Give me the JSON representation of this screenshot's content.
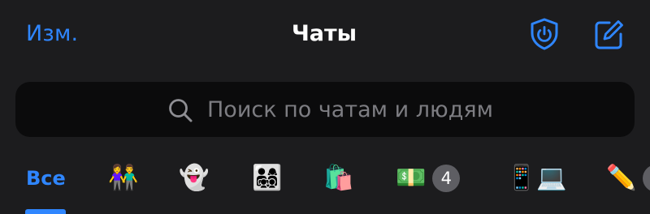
{
  "header": {
    "edit_label": "Изм.",
    "title": "Чаты",
    "shield_icon": "shield-power-icon",
    "compose_icon": "compose-icon"
  },
  "search": {
    "placeholder": "Поиск по чатам и людям",
    "value": "",
    "icon": "search-icon"
  },
  "tabs": [
    {
      "label": "Все",
      "selected": true
    },
    {
      "label": "👫"
    },
    {
      "label": "👻"
    },
    {
      "label": "👨‍👩‍👧‍👦"
    },
    {
      "label": "🛍️"
    },
    {
      "label": "💵",
      "badge": "4"
    },
    {
      "label": "📱💻"
    },
    {
      "label": "✏️"
    }
  ],
  "colors": {
    "accent": "#2f86ff",
    "background": "#1c1c1e",
    "search_bg": "#0b0b0c",
    "placeholder": "#7d7d82",
    "badge_bg": "#5e5e63"
  }
}
